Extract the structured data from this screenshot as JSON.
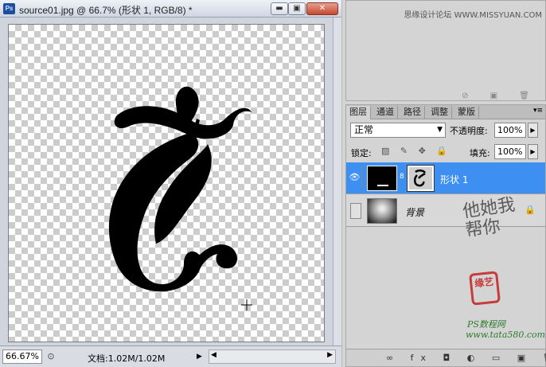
{
  "document": {
    "app_icon": "Ps",
    "title": "source01.jpg @ 66.7% (形状 1, RGB/8) *",
    "window_buttons": {
      "minimize": "▬",
      "restore": "▣",
      "close": "✕"
    }
  },
  "status": {
    "zoom": "66.67%",
    "doc_info": "文档:1.02M/1.02M",
    "arrow": "▶"
  },
  "top_panel": {
    "watermark": "思缘设计论坛 WWW.MISSYUAN.COM",
    "icons": "⊘ ▣ 🗑"
  },
  "layers": {
    "tabs": [
      "图层",
      "通道",
      "路径",
      "调整",
      "蒙版"
    ],
    "menu_icon": "▾≡",
    "blend_mode": "正常",
    "dropdown_arrow": "▼",
    "opacity_label": "不透明度:",
    "opacity_value": "100%",
    "lock_label": "锁定:",
    "lock_icons": "▨ ✎ ✥ 🔒",
    "fill_label": "填充:",
    "fill_value": "100%",
    "spinner_arrow": "▶",
    "items": [
      {
        "name": "形状 1",
        "visible_icon": "👁",
        "link_icon": "8"
      },
      {
        "name": "背景",
        "lock_icon": "🔒"
      }
    ],
    "footer_icons": "∞ fx ◘ ◐ ▭ ▣ 🗑"
  },
  "watermarks": {
    "side_text": "他她我帮你",
    "seal_text": "缘艺",
    "bottom_text": "PS数程网",
    "url": "www.tata580.com"
  },
  "colors": {
    "selected_layer": "#3d8ff2",
    "seal": "#c73b3b"
  }
}
